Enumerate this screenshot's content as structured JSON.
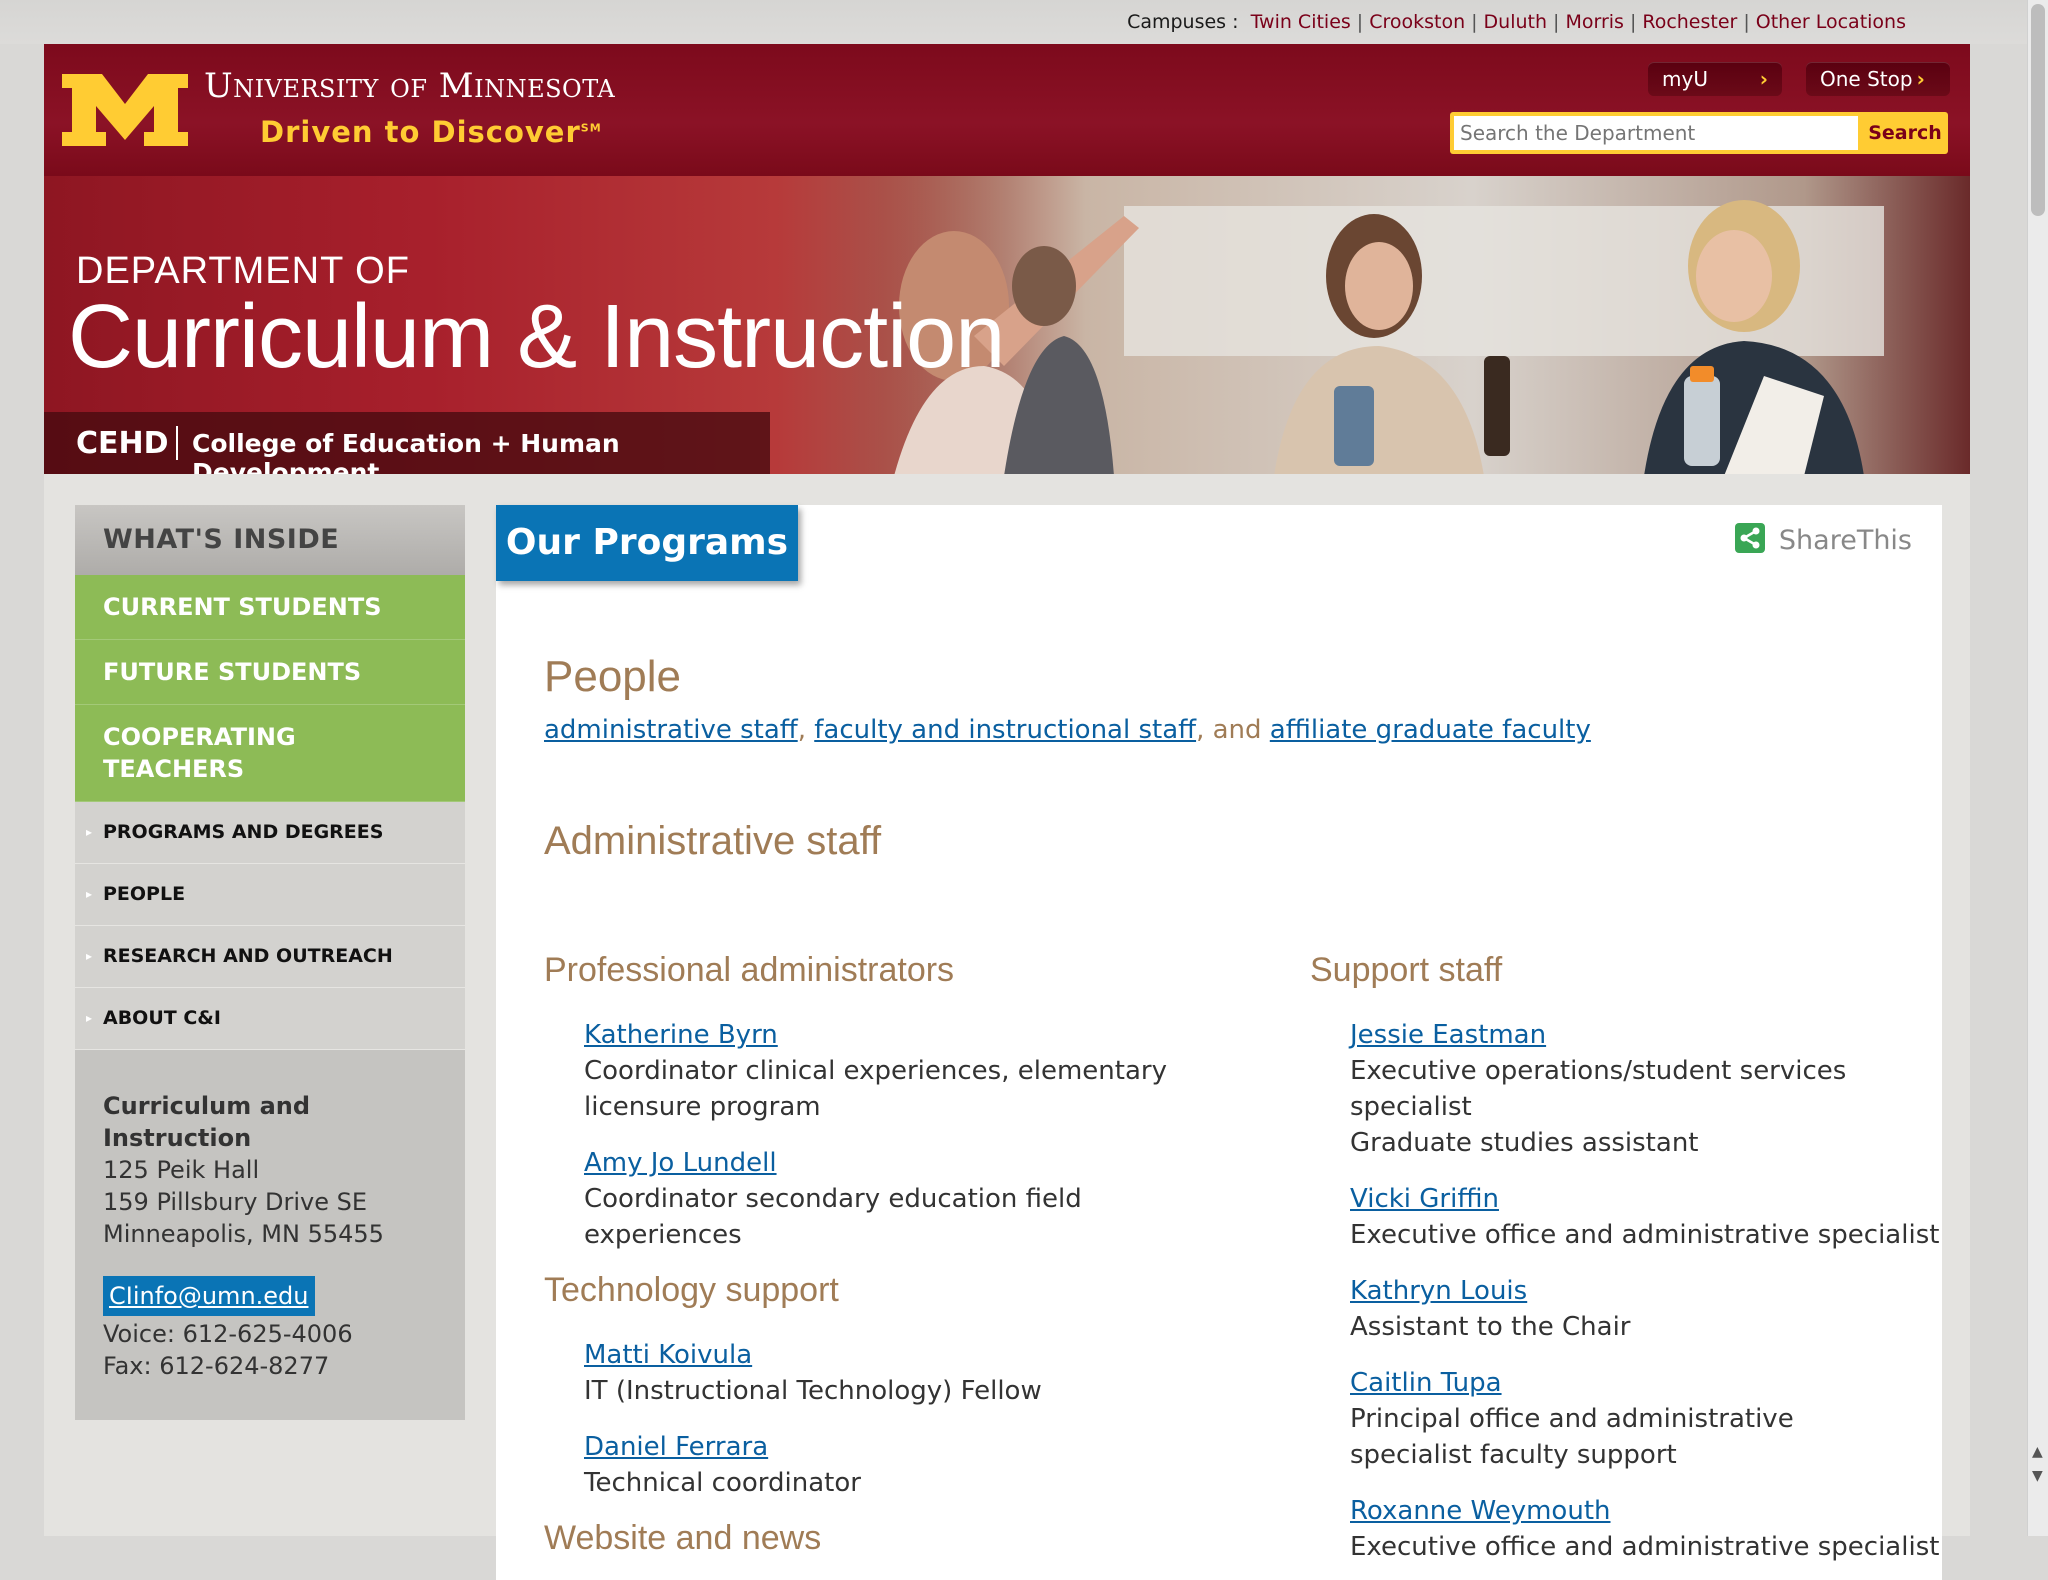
{
  "campus_bar": {
    "label": "Campuses :",
    "links": [
      "Twin Cities",
      "Crookston",
      "Duluth",
      "Morris",
      "Rochester",
      "Other Locations"
    ]
  },
  "header": {
    "university_name": "University of Minnesota",
    "tagline": "Driven to Discover",
    "tagline_mark": "SM",
    "myu_label": "myU",
    "onestop_label": "One Stop",
    "search_placeholder": "Search the Department",
    "search_button": "Search"
  },
  "banner": {
    "dept_of": "DEPARTMENT OF",
    "dept_name": "Curriculum & Instruction",
    "college_abbr": "CEHD",
    "college_name": "College of Education + Human Development"
  },
  "sidebar": {
    "heading": "WHAT'S INSIDE",
    "primary": [
      "CURRENT STUDENTS",
      "FUTURE STUDENTS",
      "COOPERATING TEACHERS"
    ],
    "secondary": [
      "PROGRAMS AND DEGREES",
      "PEOPLE",
      "RESEARCH AND OUTREACH",
      "ABOUT C&I"
    ],
    "contact": {
      "org": "Curriculum and Instruction",
      "address1": "125 Peik Hall",
      "address2": "159 Pillsbury Drive SE",
      "address3": "Minneapolis, MN 55455",
      "email": "CIinfo@umn.edu",
      "voice": "Voice: 612-625-4006",
      "fax": "Fax: 612-624-8277"
    }
  },
  "main": {
    "tab_label": "Our Programs",
    "share_label": "ShareThis",
    "people_heading": "People",
    "people_links": {
      "admin": "administrative staff",
      "sep1": ", ",
      "faculty": "faculty and instructional staff",
      "sep2": ", and ",
      "affiliate": "affiliate graduate faculty"
    },
    "admin_heading": "Administrative staff",
    "left": {
      "professional_heading": "Professional administrators",
      "professional": [
        {
          "name": "Katherine Byrn",
          "title": "Coordinator clinical experiences, elementary licensure program"
        },
        {
          "name": "Amy Jo Lundell",
          "title": "Coordinator secondary education field experiences"
        }
      ],
      "tech_heading": "Technology support",
      "tech": [
        {
          "name": "Matti Koivula",
          "title": "IT (Instructional Technology) Fellow"
        },
        {
          "name": "Daniel Ferrara",
          "title": "Technical coordinator"
        }
      ],
      "web_heading": "Website and news"
    },
    "right": {
      "support_heading": "Support staff",
      "support": [
        {
          "name": "Jessie Eastman",
          "title": "Executive operations/student services specialist",
          "title2": "Graduate studies assistant"
        },
        {
          "name": "Vicki Griffin",
          "title": "Executive office and administrative specialist"
        },
        {
          "name": "Kathryn Louis",
          "title": "Assistant to the Chair"
        },
        {
          "name": "Caitlin Tupa",
          "title": "Principal office and administrative specialist faculty support"
        },
        {
          "name": "Roxanne Weymouth",
          "title": "Executive office and administrative specialist"
        }
      ]
    }
  },
  "colors": {
    "maroon": "#7a0019",
    "gold": "#ffcc33",
    "green": "#8dbb56",
    "blue": "#0a74b5",
    "tan_heading": "#a07c56"
  }
}
